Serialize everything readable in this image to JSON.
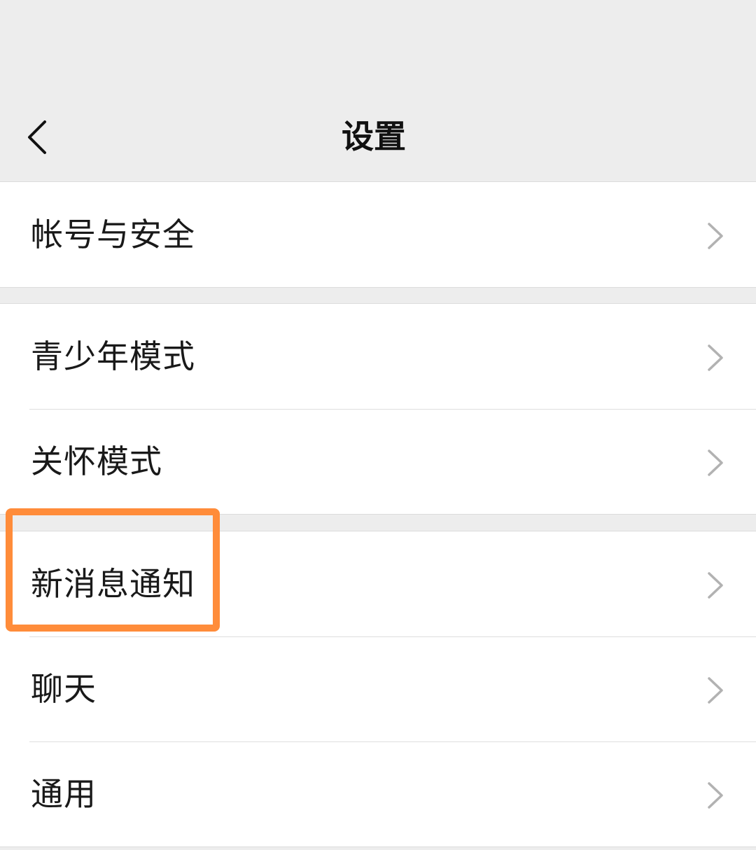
{
  "header": {
    "title": "设置",
    "back_icon": "chevron-left-icon"
  },
  "groups": [
    {
      "items": [
        {
          "label": "帐号与安全"
        }
      ]
    },
    {
      "items": [
        {
          "label": "青少年模式"
        },
        {
          "label": "关怀模式"
        }
      ]
    },
    {
      "items": [
        {
          "label": "新消息通知"
        },
        {
          "label": "聊天"
        },
        {
          "label": "通用"
        }
      ]
    }
  ],
  "highlight": {
    "target": "新消息通知",
    "color": "#ff8c3a"
  },
  "colors": {
    "background": "#ededed",
    "card": "#ffffff",
    "chevron": "#b2b2b2"
  }
}
